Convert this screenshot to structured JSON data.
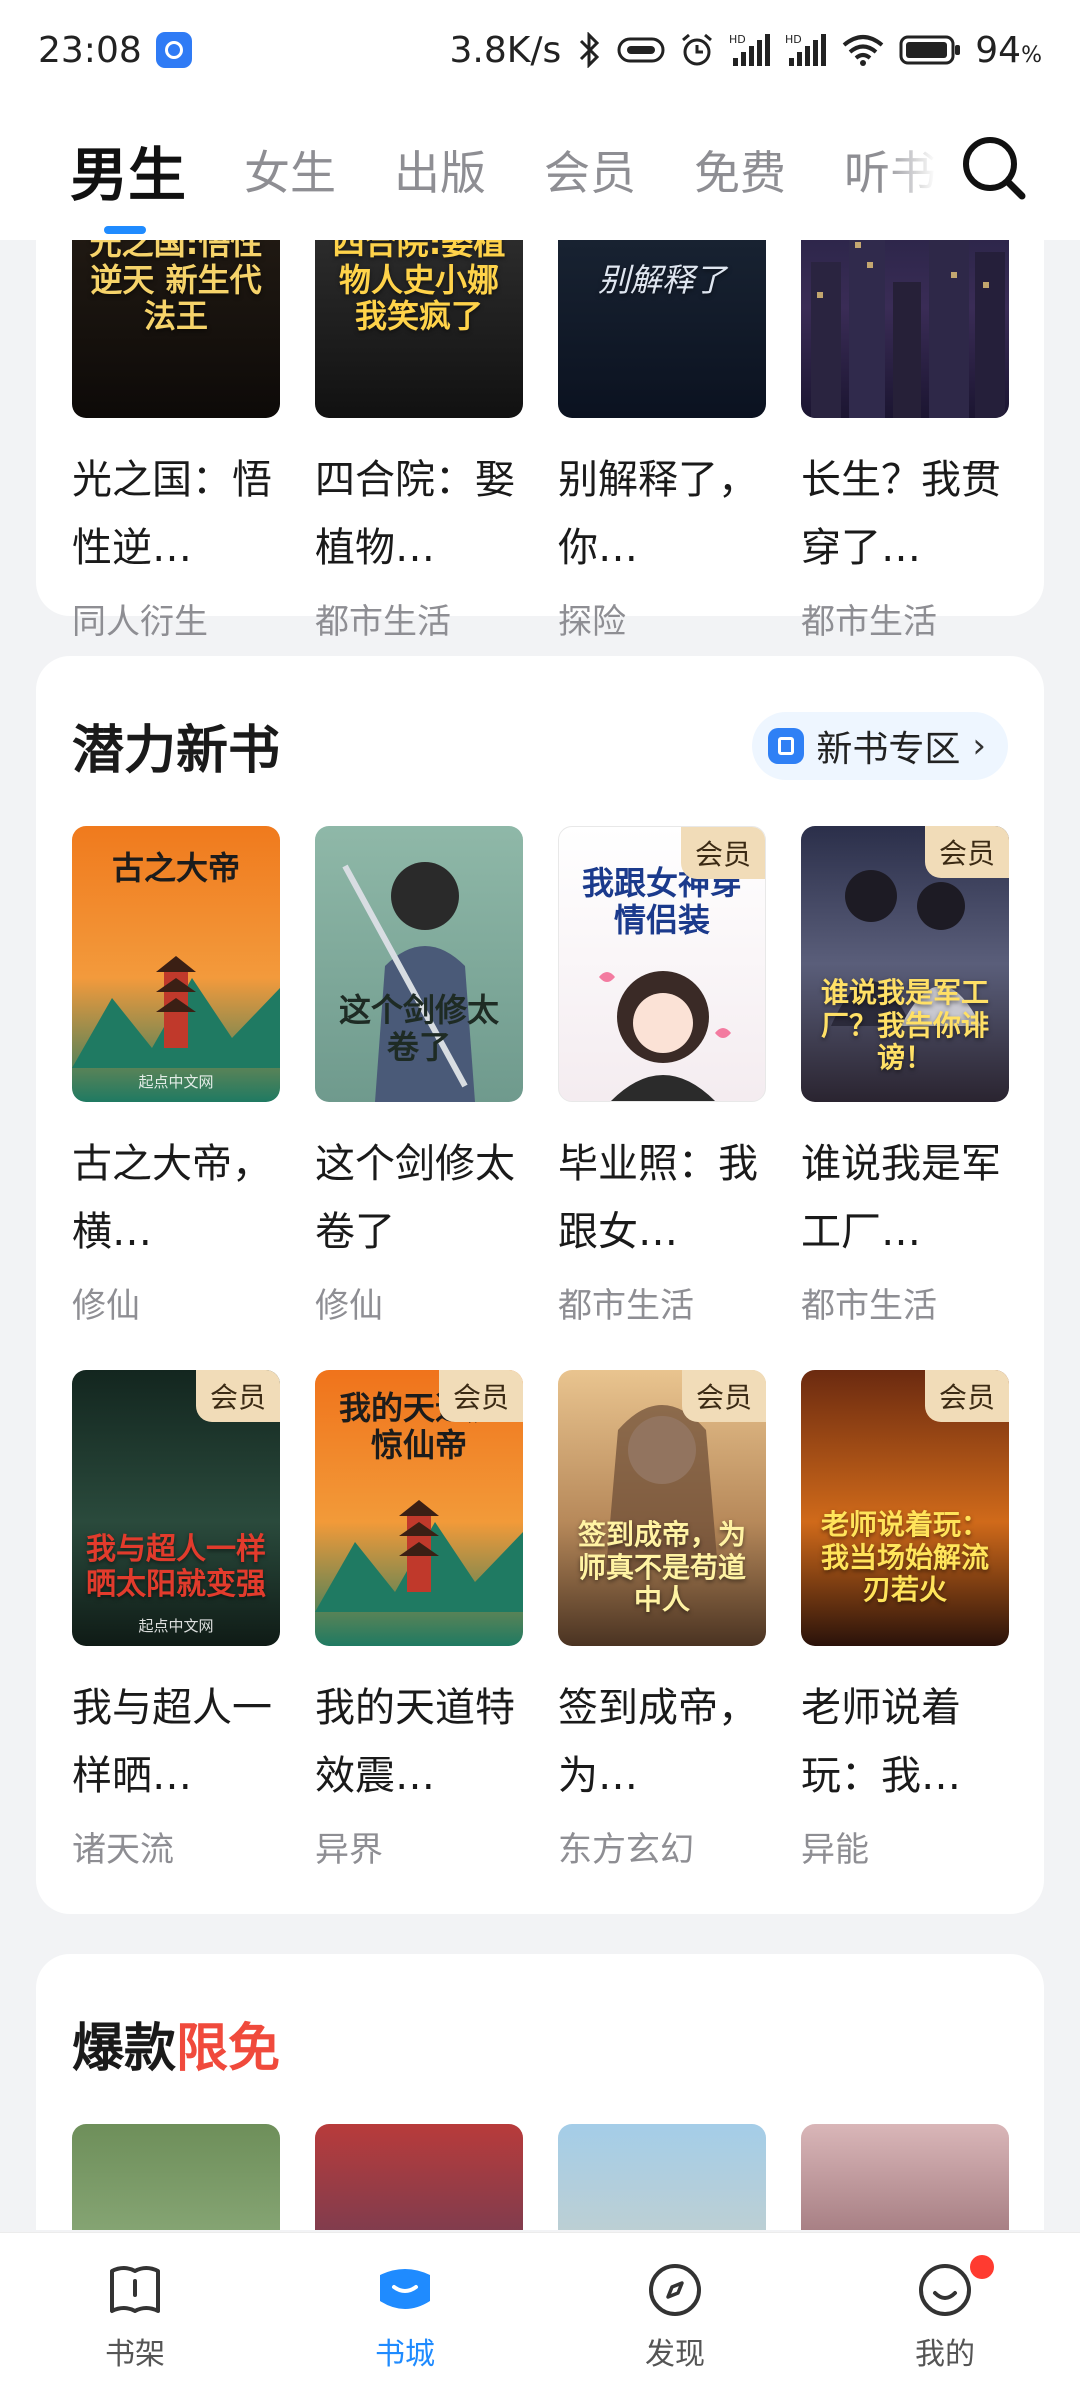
{
  "status": {
    "time": "23:08",
    "speed": "3.8K/s",
    "battery": "94",
    "battery_unit": "%",
    "signal_label_1": "HD",
    "signal_label_2": "HD"
  },
  "top_tabs": [
    {
      "label": "男生",
      "active": true
    },
    {
      "label": "女生",
      "active": false
    },
    {
      "label": "出版",
      "active": false
    },
    {
      "label": "会员",
      "active": false
    },
    {
      "label": "免费",
      "active": false
    },
    {
      "label": "听书",
      "active": false
    }
  ],
  "section_top": {
    "books": [
      {
        "cover_text": "光之国:悟性逆天 新生代法王",
        "title": "光之国：悟性逆…",
        "genre": "同人衍生"
      },
      {
        "cover_text": "四合院:娶植物人史小娜 我笑疯了",
        "title": "四合院：娶植物…",
        "genre": "都市生活"
      },
      {
        "cover_text": "别解释了",
        "title": "别解释了，你…",
        "genre": "探险"
      },
      {
        "cover_text": "",
        "title": "长生？我贯穿了…",
        "genre": "都市生活"
      }
    ]
  },
  "section_new": {
    "title": "潜力新书",
    "zone_button": "新书专区",
    "badge_label": "会员",
    "books": [
      {
        "cover_text": "古之大帝",
        "publisher": "起点中文网",
        "title": "古之大帝，横…",
        "genre": "修仙",
        "vip": false
      },
      {
        "cover_text": "这个剑修太卷了",
        "publisher": "",
        "title": "这个剑修太卷了",
        "genre": "修仙",
        "vip": false
      },
      {
        "cover_text": "我跟女神穿情侣装",
        "publisher": "",
        "title": "毕业照：我跟女…",
        "genre": "都市生活",
        "vip": true
      },
      {
        "cover_text": "谁说我是军工厂？我告你诽谤！",
        "publisher": "",
        "title": "谁说我是军工厂…",
        "genre": "都市生活",
        "vip": true
      },
      {
        "cover_text": "我与超人一样晒太阳就变强",
        "publisher": "起点中文网",
        "title": "我与超人一样晒…",
        "genre": "诸天流",
        "vip": true
      },
      {
        "cover_text": "我的天道震惊仙帝",
        "publisher": "",
        "title": "我的天道特效震…",
        "genre": "异界",
        "vip": true
      },
      {
        "cover_text": "签到成帝，为师真不是苟道中人",
        "publisher": "",
        "title": "签到成帝，为…",
        "genre": "东方玄幻",
        "vip": true
      },
      {
        "cover_text": "老师说着玩：我当场始解流刃若火",
        "publisher": "",
        "title": "老师说着玩：我…",
        "genre": "异能",
        "vip": true
      }
    ]
  },
  "section_free": {
    "title_main": "爆款",
    "title_highlight": "限免"
  },
  "bottom_nav": [
    {
      "label": "书架",
      "icon": "bookshelf-icon",
      "active": false
    },
    {
      "label": "书城",
      "icon": "bookstore-icon",
      "active": true
    },
    {
      "label": "发现",
      "icon": "compass-icon",
      "active": false
    },
    {
      "label": "我的",
      "icon": "profile-icon",
      "active": false
    }
  ],
  "colors": {
    "accent": "#1f8bff",
    "highlight_red": "#f04a3c",
    "vip_badge": "#f1dcb8"
  }
}
